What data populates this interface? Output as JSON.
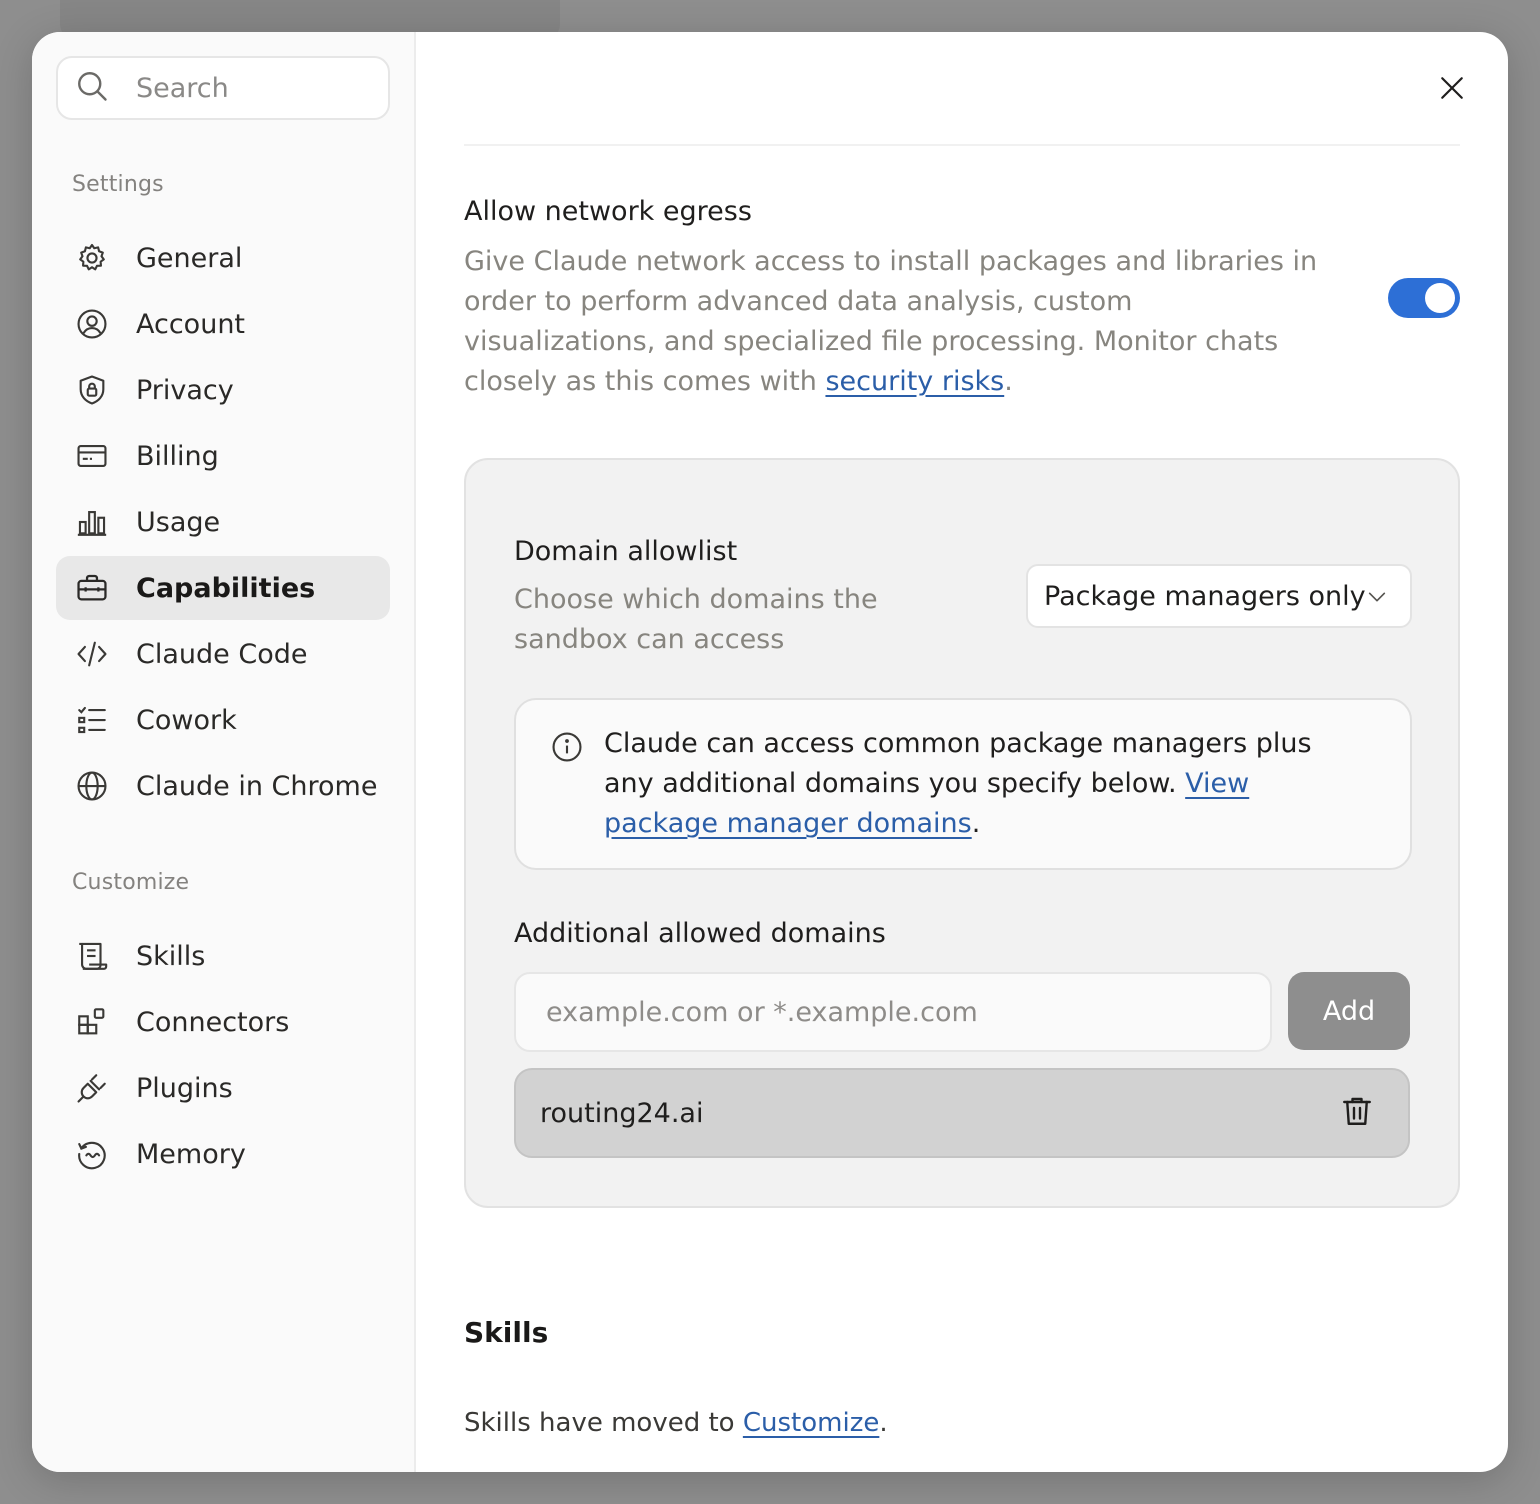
{
  "sidebar": {
    "search_placeholder": "Search",
    "settings_section": "Settings",
    "customize_section": "Customize",
    "settings_items": [
      {
        "label": "General",
        "icon": "gear-icon"
      },
      {
        "label": "Account",
        "icon": "user-circle-icon"
      },
      {
        "label": "Privacy",
        "icon": "shield-lock-icon"
      },
      {
        "label": "Billing",
        "icon": "credit-card-icon"
      },
      {
        "label": "Usage",
        "icon": "bar-chart-icon"
      },
      {
        "label": "Capabilities",
        "icon": "toolbox-icon",
        "active": true
      },
      {
        "label": "Claude Code",
        "icon": "code-icon"
      },
      {
        "label": "Cowork",
        "icon": "checklist-icon"
      },
      {
        "label": "Claude in Chrome",
        "icon": "globe-icon"
      }
    ],
    "customize_items": [
      {
        "label": "Skills",
        "icon": "scroll-icon"
      },
      {
        "label": "Connectors",
        "icon": "blocks-icon"
      },
      {
        "label": "Plugins",
        "icon": "plug-icon"
      },
      {
        "label": "Memory",
        "icon": "memory-icon"
      }
    ]
  },
  "main": {
    "egress": {
      "title": "Allow network egress",
      "description": "Give Claude network access to install packages and libraries in order to perform advanced data analysis, custom visualizations, and specialized file processing. Monitor chats closely as this comes with ",
      "link_text": "security risks",
      "period": ".",
      "enabled": true
    },
    "allowlist": {
      "title": "Domain allowlist",
      "description": "Choose which domains the sandbox can access",
      "selected": "Package managers only",
      "info_text": "Claude can access common package managers plus any additional domains you specify below. ",
      "info_link": "View package manager domains",
      "info_period": "."
    },
    "additional": {
      "title": "Additional allowed domains",
      "input_placeholder": "example.com or *.example.com",
      "add_label": "Add",
      "domains": [
        "routing24.ai"
      ]
    },
    "skills": {
      "heading": "Skills",
      "text": "Skills have moved to ",
      "link": "Customize",
      "period": "."
    }
  },
  "colors": {
    "accent": "#2d6fd6",
    "link": "#2b5ea8",
    "muted_text": "#87857f",
    "backdrop": "#8e8e8e"
  }
}
